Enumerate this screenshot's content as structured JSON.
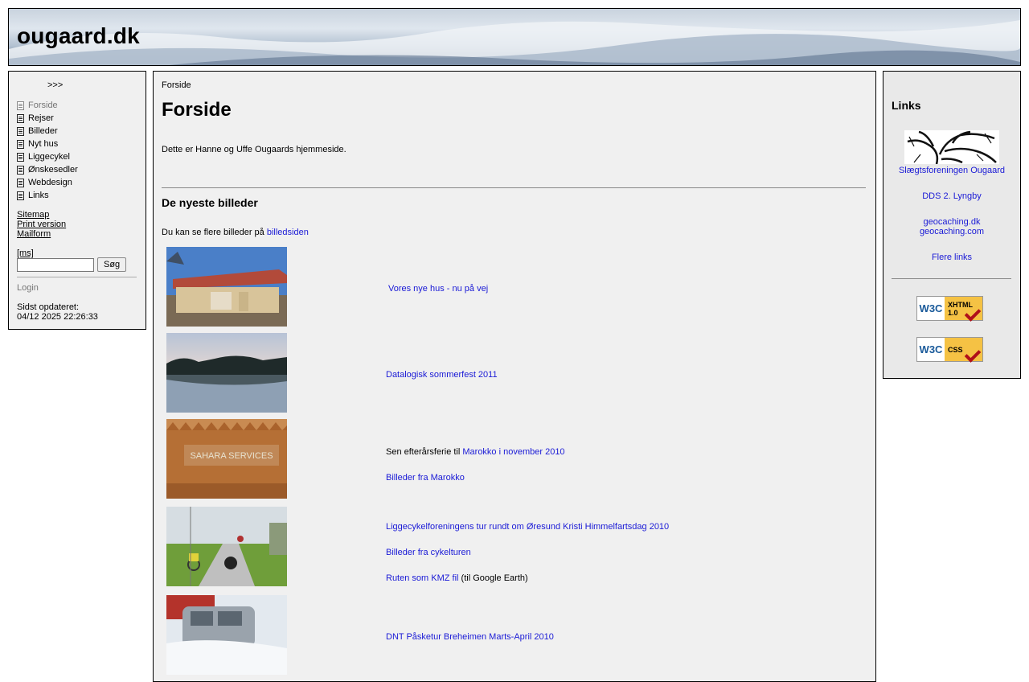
{
  "site": {
    "title": "ougaard.dk"
  },
  "left": {
    "toggle": ">>>",
    "menu": [
      {
        "label": "Forside",
        "current": true
      },
      {
        "label": "Rejser"
      },
      {
        "label": "Billeder"
      },
      {
        "label": "Nyt hus"
      },
      {
        "label": "Liggecykel"
      },
      {
        "label": "Ønskesedler"
      },
      {
        "label": "Webdesign"
      },
      {
        "label": "Links"
      }
    ],
    "util": [
      "Sitemap",
      "Print version",
      "Mailform"
    ],
    "ms": "[ms]",
    "search": {
      "value": "",
      "button": "Søg"
    },
    "login": "Login",
    "updated_label": "Sidst opdateret:",
    "updated_value": "04/12 2025 22:26:33"
  },
  "main": {
    "breadcrumb": "Forside",
    "title": "Forside",
    "intro": "Dette er Hanne og Uffe Ougaards hjemmeside.",
    "section_title": "De nyeste billeder",
    "more_prefix": "Du kan se flere billeder på ",
    "more_link": "billedsiden",
    "entries": [
      {
        "lines": [
          {
            "link": "Vores nye hus - nu på vej"
          }
        ]
      },
      {
        "lines": [
          {
            "link": "Datalogisk sommerfest 2011"
          }
        ]
      },
      {
        "lines": [
          {
            "text": "Sen efterårsferie til ",
            "link": "Marokko i november 2010"
          },
          {
            "link": "Billeder fra Marokko"
          }
        ]
      },
      {
        "lines": [
          {
            "link": "Liggecykelforeningens tur rundt om Øresund Kristi Himmelfartsdag 2010"
          },
          {
            "link": "Billeder fra cykelturen"
          },
          {
            "link": "Ruten som KMZ fil",
            "suffix": " (til Google Earth)"
          }
        ]
      },
      {
        "lines": [
          {
            "link": "DNT Påsketur Breheimen Marts-April 2010"
          }
        ]
      }
    ],
    "sign_text": "SAHARA SERVICES"
  },
  "right": {
    "title": "Links",
    "links": [
      "Slægtsforeningen Ougaard",
      "DDS 2. Lyngby",
      "geocaching.dk",
      "geocaching.com",
      "Flere links"
    ],
    "badges": [
      {
        "org": "W3C",
        "kind": "XHTML 1.0"
      },
      {
        "org": "W3C",
        "kind": "CSS"
      }
    ]
  }
}
